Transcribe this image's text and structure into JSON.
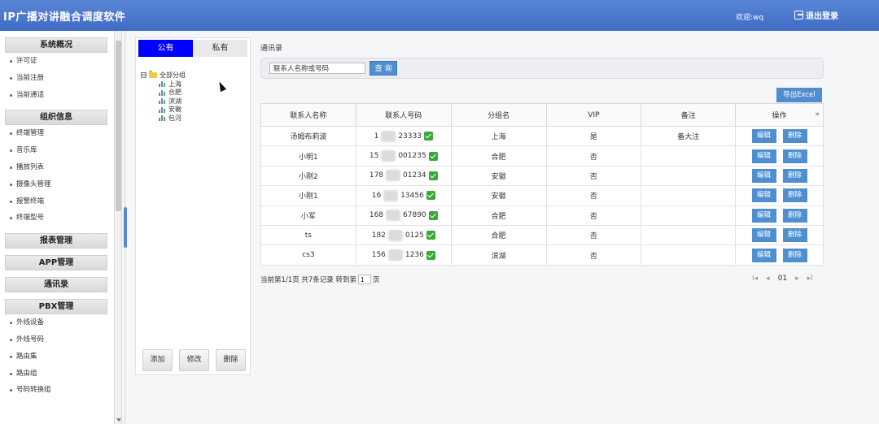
{
  "header": {
    "app_title": "IP广播对讲融合调度软件",
    "welcome": "欢迎:wq",
    "logout": "退出登录"
  },
  "sidebar": {
    "sections": [
      {
        "title": "系统概况",
        "items": [
          "许可证",
          "当前注册",
          "当前通话"
        ]
      },
      {
        "title": "组织信息",
        "items": [
          "终端管理",
          "音乐库",
          "播放列表",
          "摄像头管理",
          "报警终端",
          "终端型号"
        ]
      },
      {
        "title": "报表管理",
        "items": []
      },
      {
        "title": "APP管理",
        "items": []
      },
      {
        "title": "通讯录",
        "items": []
      },
      {
        "title": "PBX管理",
        "items": [
          "外线设备",
          "外线号码",
          "路由集",
          "路由组",
          "号码转换组"
        ]
      }
    ]
  },
  "tree_panel": {
    "tabs": [
      "公有",
      "私有"
    ],
    "root": "全部分组",
    "root_toggle": "⊟",
    "children": [
      "上海",
      "合肥",
      "滨湖",
      "安徽",
      "包河"
    ],
    "buttons": {
      "add": "添加",
      "edit": "修改",
      "delete": "删除"
    }
  },
  "main": {
    "breadcrumb": "通讯录",
    "search": {
      "placeholder": "联系人名称或号码",
      "value": "联系人名称或号码",
      "button": "查 询"
    },
    "export_button": "导出Excel",
    "columns": [
      "联系人名称",
      "联系人号码",
      "分组名",
      "VIP",
      "备注",
      "操作"
    ],
    "expand_icon": "»",
    "rows": [
      {
        "name": "汤姆布莉波",
        "phone_start": "1",
        "phone_end": "23333",
        "group": "上海",
        "vip": "是",
        "note": "备大注"
      },
      {
        "name": "小明1",
        "phone_start": "15",
        "phone_end": "001235",
        "group": "合肥",
        "vip": "否",
        "note": ""
      },
      {
        "name": "小刚2",
        "phone_start": "178",
        "phone_end": "01234",
        "group": "安徽",
        "vip": "否",
        "note": ""
      },
      {
        "name": "小刚1",
        "phone_start": "16",
        "phone_end": "13456",
        "group": "安徽",
        "vip": "否",
        "note": ""
      },
      {
        "name": "小军",
        "phone_start": "168",
        "phone_end": "67890",
        "group": "合肥",
        "vip": "否",
        "note": ""
      },
      {
        "name": "ts",
        "phone_start": "182",
        "phone_end": "0125",
        "group": "合肥",
        "vip": "否",
        "note": ""
      },
      {
        "name": "cs3",
        "phone_start": "156",
        "phone_end": "1236",
        "group": "滨湖",
        "vip": "否",
        "note": ""
      }
    ],
    "row_actions": {
      "edit": "编辑",
      "delete": "删除"
    },
    "pager": {
      "info": "当前第1/1页 共7条记录 转到第",
      "page_value": "1",
      "page_suffix": "页",
      "current": "01",
      "first": "I◂",
      "prev": "◂",
      "next": "▸",
      "last": "▸I"
    }
  }
}
